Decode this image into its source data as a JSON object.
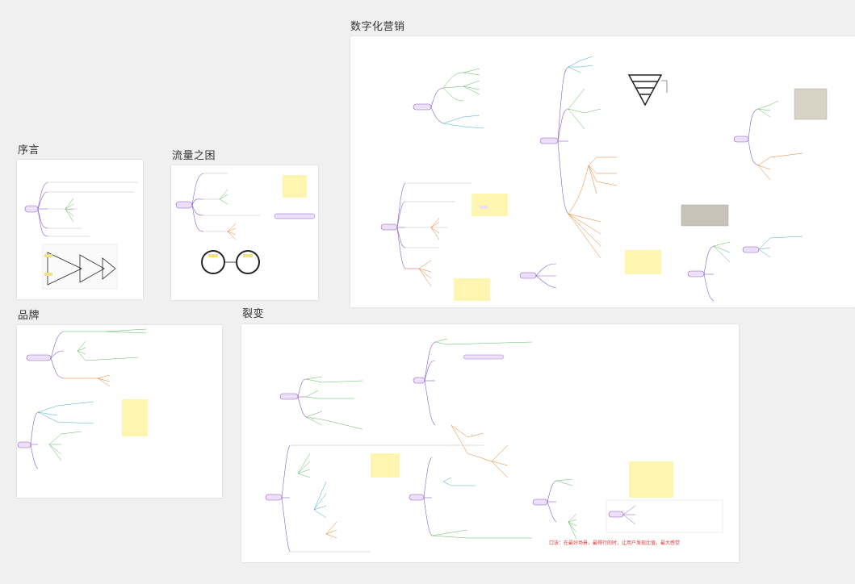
{
  "frames": {
    "preface": {
      "title": "序言"
    },
    "traffic": {
      "title": "流量之困"
    },
    "digital": {
      "title": "数字化营销"
    },
    "brand": {
      "title": "品牌"
    },
    "fission": {
      "title": "裂变"
    }
  },
  "fission_note": "口诀：在最好场景，最得行的时，让用户发现比值，最大感觉"
}
